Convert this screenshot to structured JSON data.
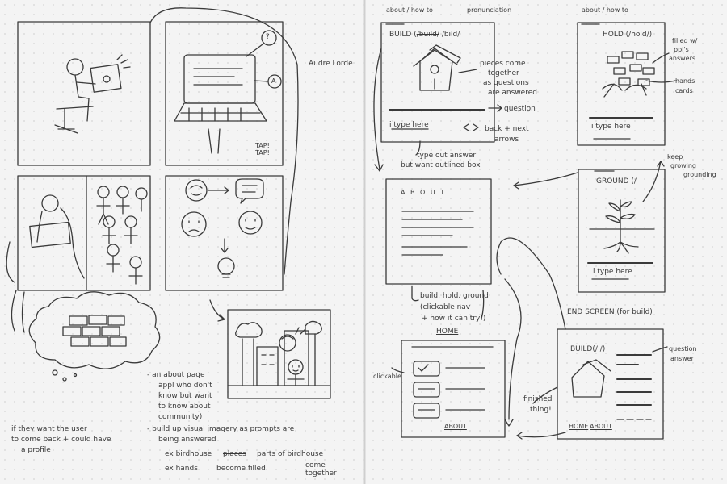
{
  "sketch": {
    "paper_color": "#f4f4f4",
    "dot_color": "#d6d6d6",
    "ink_color": "#3a3a3a",
    "left_page": {
      "label_audre_lorde": "Audre Lorde",
      "tap_label": "TAP! TAP!",
      "bubble_question": "?",
      "bubble_answer": "A",
      "notes": [
        "- an about page",
        "appl who don't",
        "know but want",
        "to know about",
        "community)",
        "- build up visual imagery as prompts are",
        "being answered",
        "ex birdhouse",
        "ex hands",
        "become filled",
        "come together"
      ],
      "birdhouse_phrase_strike": "places",
      "birdhouse_phrase": "parts of birdhouse",
      "side_note": [
        "if they want the user",
        "to come back + could have",
        "a profile"
      ]
    },
    "right_page": {
      "build_card": {
        "label_about_howto": "about / how to",
        "label_pronunciation": "pronunciation",
        "title": "BUILD (",
        "title_strike": "/build/",
        "title_end": "/bild/",
        "note_pieces": [
          "pieces come",
          "together",
          "as questions",
          "are answered"
        ],
        "note_question": "question",
        "input_placeholder": "i type here",
        "note_back_next": [
          "back + next",
          "arrows"
        ],
        "note_typeout": [
          "type out answer",
          "but want outlined box"
        ]
      },
      "hold_card": {
        "label_about_howto": "about / how to",
        "title": "HOLD (/hold/)",
        "note_filled": [
          "filled w/",
          "ppl's",
          "answers"
        ],
        "note_hands": [
          "hands",
          "cards"
        ],
        "input_placeholder": "i type here"
      },
      "ground_card": {
        "title": "GROUND (/",
        "note_keep": [
          "keep",
          "growing",
          "grounding"
        ],
        "input_placeholder": "i type here"
      },
      "about_card": {
        "title": "A B O U T",
        "note_links": [
          "build, hold, ground",
          "(clickable nav",
          "+ how it can try!)"
        ],
        "home_label": "HOME"
      },
      "home_card": {
        "clickable_label": "clickable",
        "about_link": "ABOUT"
      },
      "end_card": {
        "heading": "END SCREEN (for build)",
        "title": "BUILD(/  /)",
        "note_qa": [
          "question",
          "answer"
        ],
        "note_finished": [
          "finished",
          "thing!"
        ],
        "home_link": "HOME",
        "about_link": "ABOUT"
      }
    }
  }
}
